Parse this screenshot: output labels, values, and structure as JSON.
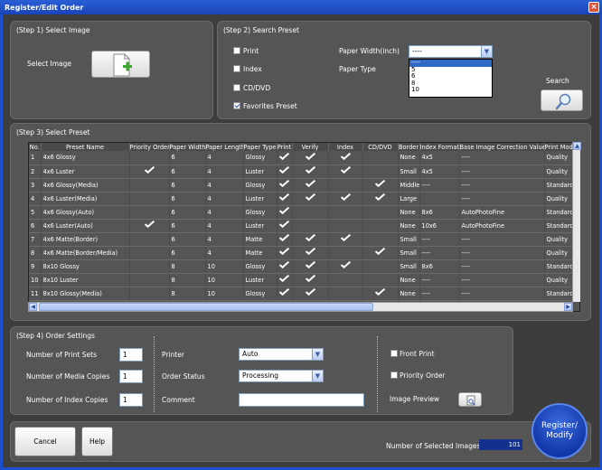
{
  "window": {
    "title": "Register/Edit Order"
  },
  "step1": {
    "title": "(Step 1) Select Image",
    "label": "Select Image"
  },
  "step2": {
    "title": "(Step 2) Search Preset",
    "print": "Print",
    "index": "Index",
    "cddvd": "CD/DVD",
    "favorites": "Favorites Preset",
    "paper_width_label": "Paper Width(inch)",
    "paper_type_label": "Paper Type",
    "paper_width_value": "----",
    "paper_width_options": [
      "----",
      "5",
      "6",
      "8",
      "10"
    ],
    "search_label": "Search"
  },
  "step3": {
    "title": "(Step 3) Select Preset",
    "columns": [
      "No.",
      "Preset Name",
      "Priority Order",
      "Paper Width",
      "Paper Length",
      "Paper Type",
      "Print",
      "Verify",
      "Index",
      "CD/DVD",
      "Border",
      "Index Format",
      "Base Image Correction Value",
      "Print Mode"
    ],
    "rows": [
      {
        "no": "1",
        "name": "4x6 Glossy",
        "priority": false,
        "width": "6",
        "length": "4",
        "type": "Glossy",
        "print": true,
        "verify": true,
        "index": true,
        "cd": false,
        "border": "None",
        "format": "4x5",
        "correction": "----",
        "mode": "Quality"
      },
      {
        "no": "2",
        "name": "4x6 Luster",
        "priority": true,
        "width": "6",
        "length": "4",
        "type": "Luster",
        "print": true,
        "verify": true,
        "index": true,
        "cd": false,
        "border": "Small",
        "format": "4x5",
        "correction": "----",
        "mode": "Quality"
      },
      {
        "no": "3",
        "name": "4x6 Glossy(Media)",
        "priority": false,
        "width": "6",
        "length": "4",
        "type": "Glossy",
        "print": true,
        "verify": true,
        "index": false,
        "cd": true,
        "border": "Middle",
        "format": "----",
        "correction": "----",
        "mode": "Standard"
      },
      {
        "no": "4",
        "name": "4x6 Luster(Media)",
        "priority": false,
        "width": "6",
        "length": "4",
        "type": "Luster",
        "print": true,
        "verify": true,
        "index": true,
        "cd": true,
        "border": "Large",
        "format": "",
        "correction": "----",
        "mode": "Quality"
      },
      {
        "no": "5",
        "name": "4x6 Glossy(Auto)",
        "priority": false,
        "width": "6",
        "length": "4",
        "type": "Glossy",
        "print": true,
        "verify": false,
        "index": false,
        "cd": false,
        "border": "None",
        "format": "8x6",
        "correction": "AutoPhotoFine",
        "mode": "Standard"
      },
      {
        "no": "6",
        "name": "4x6 Luster(Auto)",
        "priority": true,
        "width": "6",
        "length": "4",
        "type": "Luster",
        "print": true,
        "verify": false,
        "index": false,
        "cd": false,
        "border": "None",
        "format": "10x6",
        "correction": "AutoPhotoFine",
        "mode": "Standard"
      },
      {
        "no": "7",
        "name": "4x6 Matte(Border)",
        "priority": false,
        "width": "6",
        "length": "4",
        "type": "Matte",
        "print": true,
        "verify": true,
        "index": true,
        "cd": false,
        "border": "Small",
        "format": "----",
        "correction": "----",
        "mode": "Quality"
      },
      {
        "no": "8",
        "name": "4x6 Matte(Border/Media)",
        "priority": false,
        "width": "6",
        "length": "4",
        "type": "Matte",
        "print": true,
        "verify": true,
        "index": false,
        "cd": true,
        "border": "Small",
        "format": "----",
        "correction": "----",
        "mode": "Quality"
      },
      {
        "no": "9",
        "name": "8x10 Glossy",
        "priority": false,
        "width": "8",
        "length": "10",
        "type": "Glossy",
        "print": true,
        "verify": true,
        "index": true,
        "cd": false,
        "border": "Small",
        "format": "8x6",
        "correction": "----",
        "mode": "Standard"
      },
      {
        "no": "10",
        "name": "8x10 Luster",
        "priority": false,
        "width": "8",
        "length": "10",
        "type": "Luster",
        "print": true,
        "verify": true,
        "index": false,
        "cd": false,
        "border": "None",
        "format": "----",
        "correction": "----",
        "mode": "Quality"
      },
      {
        "no": "11",
        "name": "8x10 Glossy(Media)",
        "priority": false,
        "width": "8",
        "length": "10",
        "type": "Glossy",
        "print": true,
        "verify": true,
        "index": false,
        "cd": true,
        "border": "None",
        "format": "----",
        "correction": "----",
        "mode": "Standard"
      }
    ]
  },
  "step4": {
    "title": "(Step 4) Order Settings",
    "num_print_sets_label": "Number of Print Sets",
    "num_print_sets": "1",
    "num_media_copies_label": "Number of Media Copies",
    "num_media_copies": "1",
    "num_index_copies_label": "Number of Index Copies",
    "num_index_copies": "1",
    "printer_label": "Printer",
    "printer_value": "Auto",
    "order_status_label": "Order Status",
    "order_status_value": "Processing",
    "comment_label": "Comment",
    "comment_value": "",
    "front_print": "Front Print",
    "priority_order": "Priority Order",
    "image_preview": "Image Preview"
  },
  "footer": {
    "cancel": "Cancel",
    "help": "Help",
    "selected_label": "Number of Selected Images:",
    "selected_count": "101",
    "register": "Register/ Modify"
  }
}
